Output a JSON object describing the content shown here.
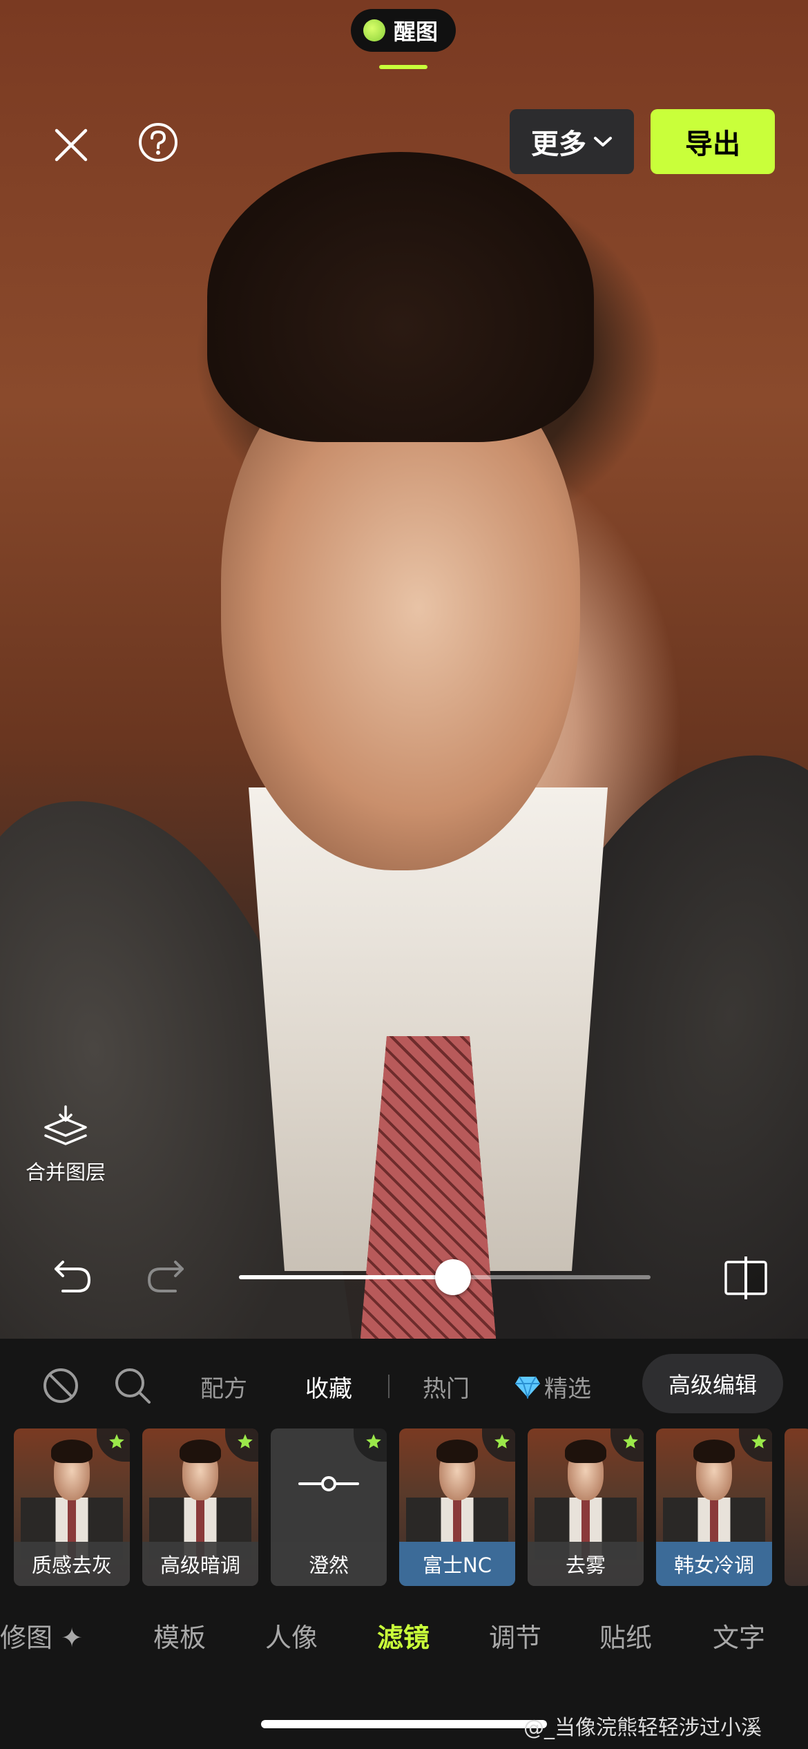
{
  "app_pill": {
    "label": "醒图"
  },
  "toolbar": {
    "more_label": "更多",
    "export_label": "导出"
  },
  "merge_layers": {
    "label": "合并图层"
  },
  "intensity_slider": {
    "value_fraction": 0.52
  },
  "categories": {
    "tabs": [
      {
        "label": "配方",
        "active": false
      },
      {
        "label": "收藏",
        "active": true
      },
      {
        "label": "热门",
        "active": false
      },
      {
        "label": "精选",
        "active": false
      }
    ],
    "advanced_button": "高级编辑"
  },
  "filters": [
    {
      "name": "质感去灰",
      "favorite": true,
      "style": "default"
    },
    {
      "name": "高级暗调",
      "favorite": true,
      "style": "default"
    },
    {
      "name": "澄然",
      "favorite": true,
      "style": "adjust"
    },
    {
      "name": "富士NC",
      "favorite": true,
      "style": "blue"
    },
    {
      "name": "去雾",
      "favorite": true,
      "style": "default"
    },
    {
      "name": "韩女冷调",
      "favorite": true,
      "style": "blue"
    }
  ],
  "tool_tabs": [
    {
      "label": "修图 ✦",
      "active": false
    },
    {
      "label": "模板",
      "active": false
    },
    {
      "label": "人像",
      "active": false
    },
    {
      "label": "滤镜",
      "active": true
    },
    {
      "label": "调节",
      "active": false
    },
    {
      "label": "贴纸",
      "active": false
    },
    {
      "label": "文字",
      "active": false
    }
  ],
  "watermark": "@_当像浣熊轻轻涉过小溪",
  "colors": {
    "accent": "#c9ff3a",
    "panel_bg": "#151515",
    "tag_blue": "#3c6b98"
  },
  "icons": [
    "close-icon",
    "help-icon",
    "chevron-down-icon",
    "merge-layers-icon",
    "undo-icon",
    "redo-icon",
    "compare-icon",
    "none-icon",
    "search-icon",
    "diamond-icon",
    "star-icon",
    "slider-adjust-icon"
  ]
}
